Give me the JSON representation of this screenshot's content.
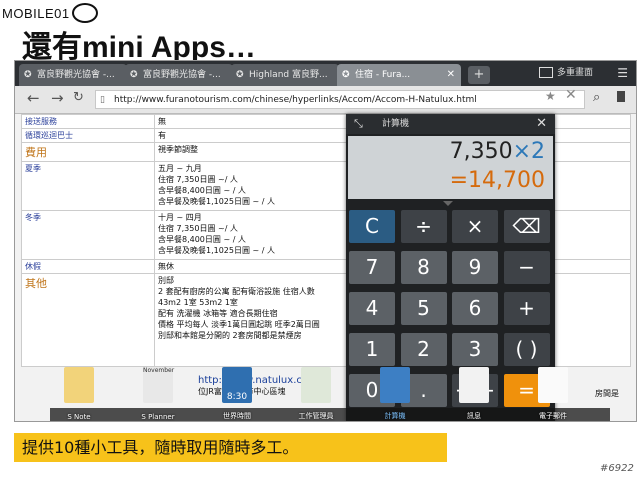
{
  "slide": {
    "logo": "MOBILE01",
    "title": "還有mini Apps…",
    "caption": "提供10種小工具，隨時取用隨時多工。",
    "watermark": "#6922"
  },
  "browser": {
    "tabs": [
      {
        "label": "富良野觀光協會 -..."
      },
      {
        "label": "富良野觀光協會 -..."
      },
      {
        "label": "Highland 富良野..."
      },
      {
        "label": "住宿 - Fura..."
      }
    ],
    "multi_screen_label": "多重畫面",
    "url": "http://www.furanotourism.com/chinese/hyperlinks/Accom/Accom-H-Natulux.html"
  },
  "page": {
    "rows": [
      {
        "key": "接送服務",
        "lines": [
          "無"
        ]
      },
      {
        "key": "循環巡迴巴士",
        "lines": [
          "有"
        ]
      },
      {
        "key": "費用",
        "lines": [
          "視季節調整"
        ]
      },
      {
        "key": "夏季",
        "lines": [
          "五月 ~ 九月",
          "住宿 7,350日圓 ~/ 人",
          "含早餐8,400日圓 ~ / 人",
          "含早餐及晚餐1,1025日圓 ~ / 人"
        ]
      },
      {
        "key": "冬季",
        "lines": [
          "十月 ~ 四月",
          "住宿 7,350日圓 ~/ 人",
          "含早餐8,400日圓 ~ / 人",
          "含早餐及晚餐1,1025日圓 ~ / 人"
        ]
      },
      {
        "key": "休假",
        "lines": [
          "無休"
        ]
      },
      {
        "key": "其他",
        "lines": [
          "",
          "別邸",
          "2 套配有廚房的公寓 配有衛浴設施 住宿人數",
          "43m2  1室 53m2  1室",
          "配有 洗濯機 冰箱等 適合長期住宿",
          "價格 平均每人 淡季1萬日圓起跳 旺季2萬日圓",
          "別邸和本館是分開的 2套房間都是禁煙房"
        ]
      }
    ],
    "link_fragment": "http://www.natulux.com/",
    "link_fragment2": "位JR富良野...市中心區塊",
    "right_bottom_text": "房間是"
  },
  "calculator": {
    "title": "計算機",
    "expression_value": "7,350",
    "expression_op": "×2",
    "result": "=14,700",
    "keys": [
      {
        "label": "C",
        "kind": "clear"
      },
      {
        "label": "÷",
        "kind": "fn"
      },
      {
        "label": "×",
        "kind": "fn"
      },
      {
        "label": "⌫",
        "kind": "fn"
      },
      {
        "label": "7",
        "kind": "num"
      },
      {
        "label": "8",
        "kind": "num"
      },
      {
        "label": "9",
        "kind": "num"
      },
      {
        "label": "−",
        "kind": "fn"
      },
      {
        "label": "4",
        "kind": "num"
      },
      {
        "label": "5",
        "kind": "num"
      },
      {
        "label": "6",
        "kind": "num"
      },
      {
        "label": "+",
        "kind": "fn"
      },
      {
        "label": "1",
        "kind": "num"
      },
      {
        "label": "2",
        "kind": "num"
      },
      {
        "label": "3",
        "kind": "num"
      },
      {
        "label": "( )",
        "kind": "fn"
      },
      {
        "label": "0",
        "kind": "num"
      },
      {
        "label": ".",
        "kind": "num"
      },
      {
        "label": "+/−",
        "kind": "fn"
      },
      {
        "label": "=",
        "kind": "eq"
      }
    ]
  },
  "dock": {
    "apps": [
      {
        "label": "S Note",
        "color": "#f2d37a"
      },
      {
        "label": "S Planner",
        "color": "#e8e8e8"
      },
      {
        "label": "世界時間",
        "color": "#2f6fb0"
      },
      {
        "label": "工作管理員",
        "color": "#dfe8d9"
      },
      {
        "label": "計算機",
        "color": "#3d7fc4"
      },
      {
        "label": "訊息",
        "color": "#f2f2f2"
      },
      {
        "label": "電子郵件",
        "color": "#fafafa"
      }
    ],
    "clock": "8:30",
    "calendar_month": "November"
  }
}
